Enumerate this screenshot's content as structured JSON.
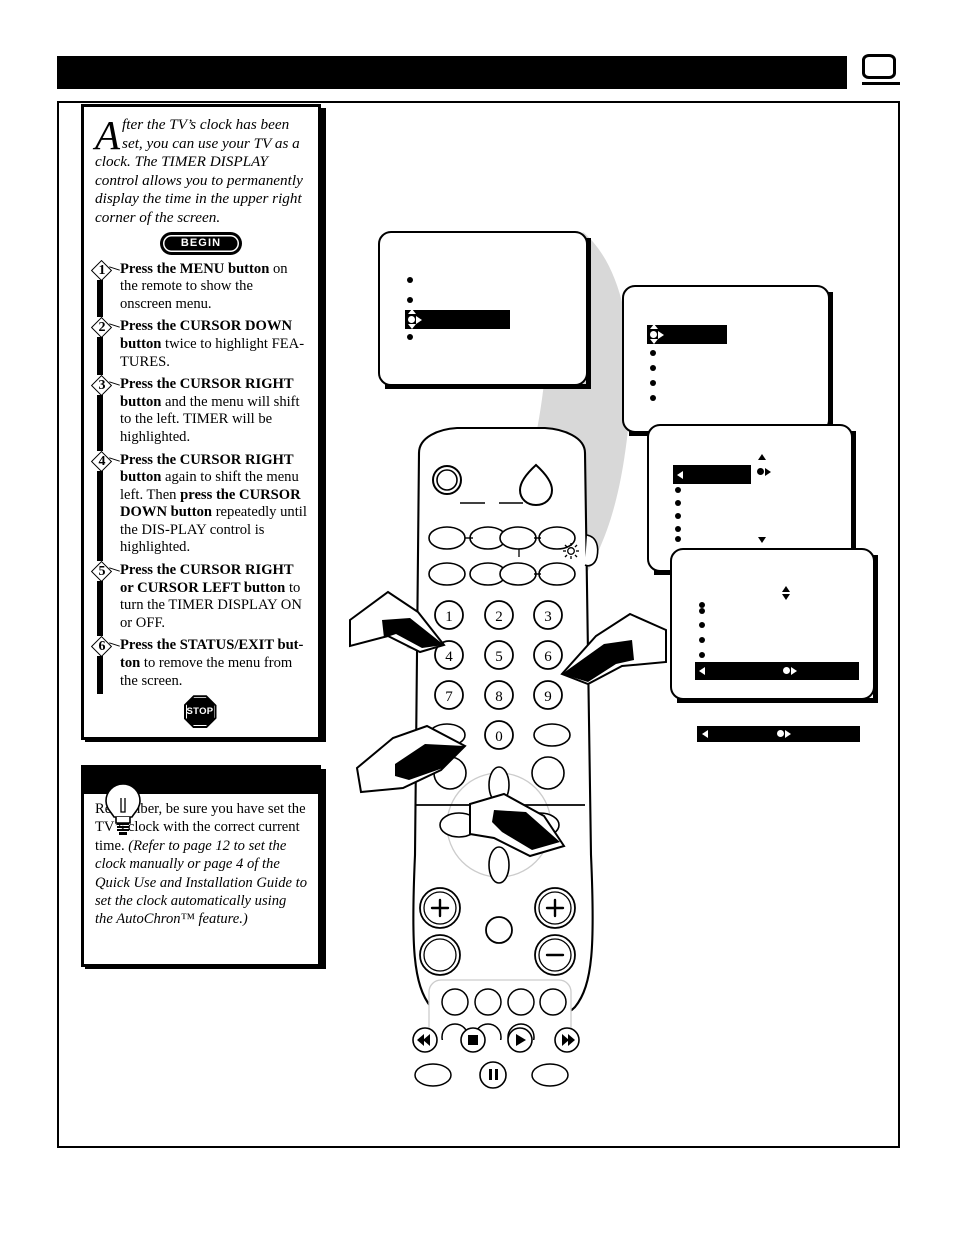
{
  "page": {
    "header_title": "",
    "corner_icon": "tv-screen-icon"
  },
  "intro": {
    "dropcap": "A",
    "text": "fter the TV’s clock has been set, you can use your TV as a clock. The TIMER DISPLAY control allows you to permanently display the time in the upper right corner of the screen.",
    "begin_label": "BEGIN"
  },
  "steps": [
    {
      "number": "1",
      "bold_lead": "Press the MENU button",
      "rest": " on the remote to show the onscreen menu."
    },
    {
      "number": "2",
      "bold_lead": "Press the CURSOR DOWN button",
      "rest": " twice to highlight FEA-TURES."
    },
    {
      "number": "3",
      "bold_lead": "Press the CURSOR RIGHT button",
      "rest": " and the menu will shift to the left. TIMER will be highlighted."
    },
    {
      "number": "4",
      "bold_lead": "Press the CURSOR RIGHT button",
      "rest": " again to shift the menu left. Then ",
      "bold_mid": "press the CURSOR DOWN button",
      "rest2": " repeatedly until the DIS-PLAY control is highlighted."
    },
    {
      "number": "5",
      "bold_lead": "Press the CURSOR RIGHT or CURSOR LEFT button",
      "rest": " to turn the TIMER DISPLAY ON or OFF."
    },
    {
      "number": "6",
      "bold_lead": "Press the STATUS/EXIT but-ton",
      "rest": " to remove the menu from the screen."
    }
  ],
  "stop_label": "STOP",
  "tip": {
    "icon": "lightbulb-icon",
    "text_plain": "Remember, be sure you have set the TV’s clock with the correct current time.  ",
    "text_italic": "(Refer to page 12 to set the clock manually or page 4 of the Quick Use and Installation Guide to set the clock automatically using the AutoChron™ feature.)"
  },
  "tv_screens": [
    {
      "name": "menu-screen-1",
      "bullets": 3,
      "highlight_row": 3
    },
    {
      "name": "menu-screen-2",
      "bullets": 4,
      "highlight_row": 1
    },
    {
      "name": "menu-screen-3",
      "bullets": 5,
      "highlight_row": 1
    },
    {
      "name": "menu-screen-4",
      "bullets": 4,
      "highlight_row": 5
    }
  ],
  "remote": {
    "name": "remote-control",
    "keypad": [
      "1",
      "2",
      "3",
      "4",
      "5",
      "6",
      "7",
      "8",
      "9",
      "0"
    ],
    "transport": [
      "rewind-icon",
      "stop-icon",
      "play-icon",
      "fast-forward-icon",
      "pause-icon"
    ],
    "plus_label": "+",
    "minus_label": "−"
  },
  "colors": {
    "ink": "#000000",
    "beam": "#d8d8d8",
    "paper": "#ffffff"
  }
}
